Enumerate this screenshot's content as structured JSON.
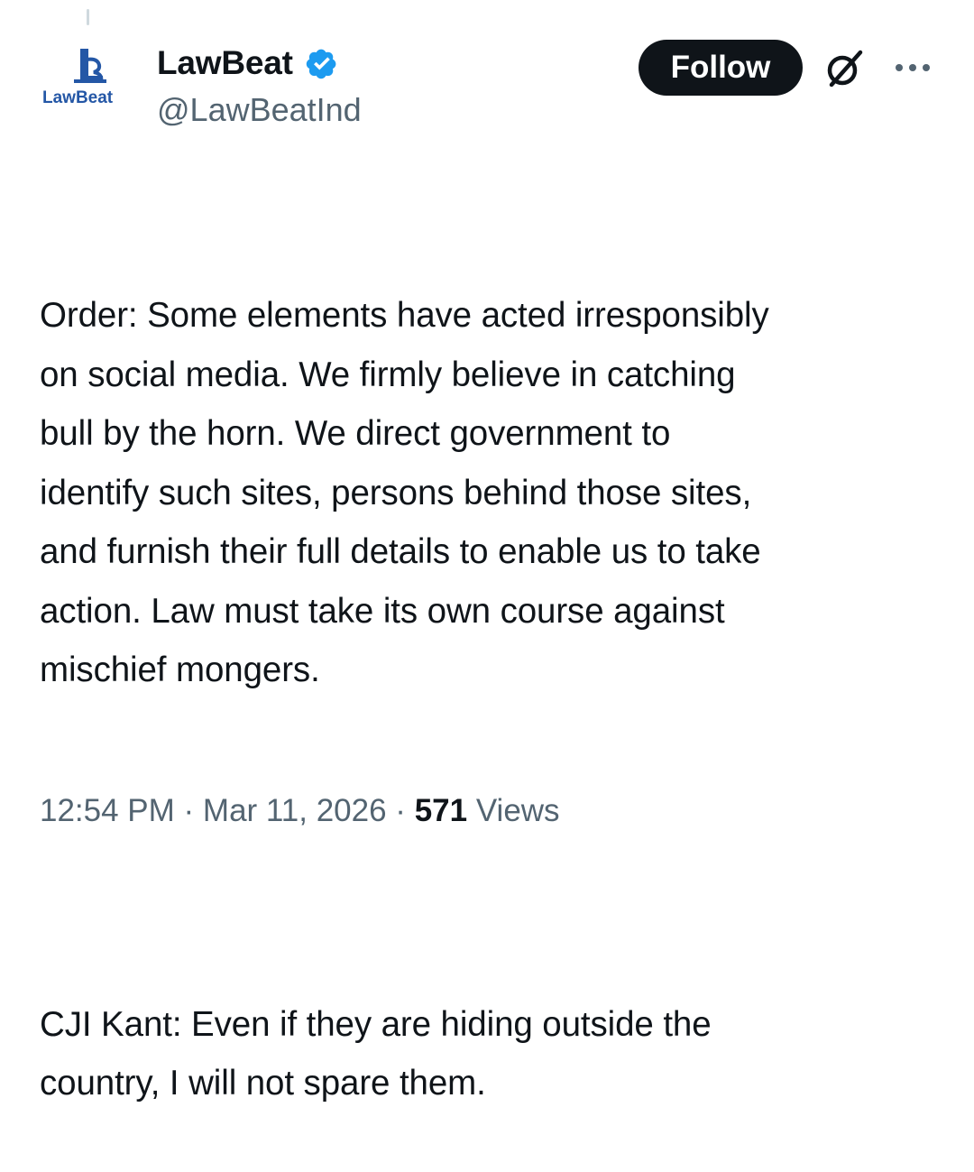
{
  "author": {
    "avatar_text": "LawBeat",
    "display_name": "LawBeat",
    "handle": "@LawBeatInd",
    "verified": true
  },
  "actions": {
    "follow_label": "Follow",
    "grok_icon": "grok-slash-circle-icon",
    "more_icon": "more-horizontal-icon"
  },
  "tweet": {
    "paragraph_1": "Order: Some elements have acted irresponsibly\non social media. We firmly believe in catching\nbull by the horn. We direct government to\nidentify such sites, persons behind those sites,\nand furnish their full details to enable us to take\naction. Law must take its own course against\nmischief mongers.",
    "paragraph_2": "CJI Kant: Even if they are hiding outside the\ncountry, I will not spare them."
  },
  "meta": {
    "time": "12:54 PM",
    "separator": " · ",
    "date": "Mar 11, 2026",
    "views_count": "571",
    "views_label": "Views"
  },
  "colors": {
    "text_primary": "#0f1419",
    "text_secondary": "#536471",
    "verified_blue": "#1d9bf0",
    "logo_blue": "#2457a6",
    "follow_bg": "#0f1419"
  }
}
